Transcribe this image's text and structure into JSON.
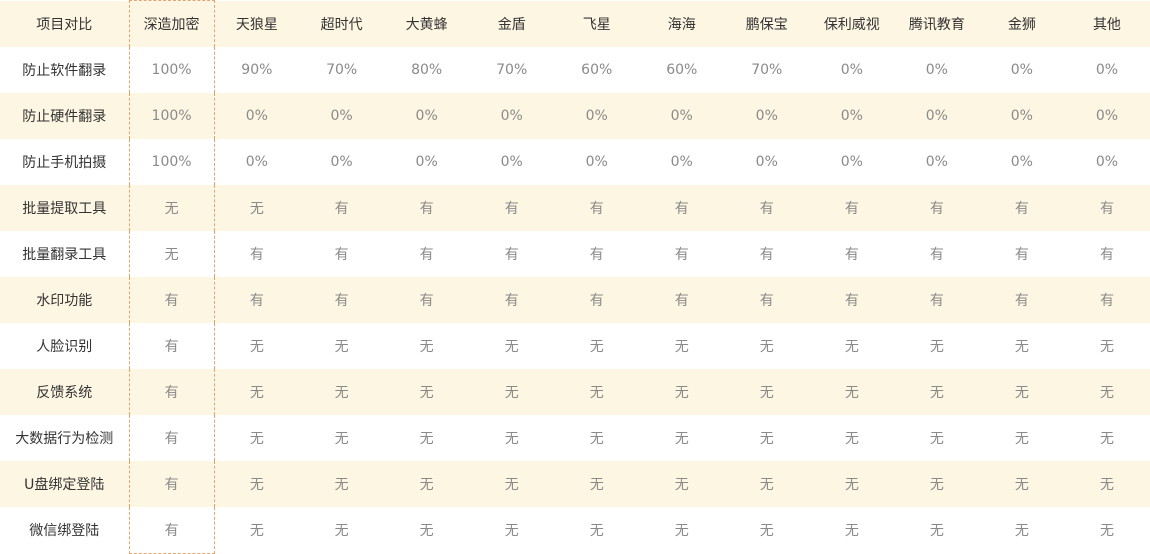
{
  "table": {
    "corner": "项目对比",
    "columns": [
      "深造加密",
      "天狼星",
      "超时代",
      "大黄蜂",
      "金盾",
      "飞星",
      "海海",
      "鹏保宝",
      "保利威视",
      "腾讯教育",
      "金狮",
      "其他"
    ],
    "highlight_column": "深造加密",
    "colors": {
      "shaded_row_bg": "#fdf6e3",
      "highlight_border": "#e8a36b",
      "label_text": "#333333",
      "value_text": "#8a8a8a"
    },
    "rows": [
      {
        "label": "防止软件翻录",
        "values": [
          "100%",
          "90%",
          "70%",
          "80%",
          "70%",
          "60%",
          "60%",
          "70%",
          "0%",
          "0%",
          "0%",
          "0%"
        ]
      },
      {
        "label": "防止硬件翻录",
        "values": [
          "100%",
          "0%",
          "0%",
          "0%",
          "0%",
          "0%",
          "0%",
          "0%",
          "0%",
          "0%",
          "0%",
          "0%"
        ]
      },
      {
        "label": "防止手机拍摄",
        "values": [
          "100%",
          "0%",
          "0%",
          "0%",
          "0%",
          "0%",
          "0%",
          "0%",
          "0%",
          "0%",
          "0%",
          "0%"
        ]
      },
      {
        "label": "批量提取工具",
        "values": [
          "无",
          "无",
          "有",
          "有",
          "有",
          "有",
          "有",
          "有",
          "有",
          "有",
          "有",
          "有"
        ]
      },
      {
        "label": "批量翻录工具",
        "values": [
          "无",
          "有",
          "有",
          "有",
          "有",
          "有",
          "有",
          "有",
          "有",
          "有",
          "有",
          "有"
        ]
      },
      {
        "label": "水印功能",
        "values": [
          "有",
          "有",
          "有",
          "有",
          "有",
          "有",
          "有",
          "有",
          "有",
          "有",
          "有",
          "有"
        ]
      },
      {
        "label": "人脸识别",
        "values": [
          "有",
          "无",
          "无",
          "无",
          "无",
          "无",
          "无",
          "无",
          "无",
          "无",
          "无",
          "无"
        ]
      },
      {
        "label": "反馈系统",
        "values": [
          "有",
          "无",
          "无",
          "无",
          "无",
          "无",
          "无",
          "无",
          "无",
          "无",
          "无",
          "无"
        ]
      },
      {
        "label": "大数据行为检测",
        "values": [
          "有",
          "无",
          "无",
          "无",
          "无",
          "无",
          "无",
          "无",
          "无",
          "无",
          "无",
          "无"
        ]
      },
      {
        "label": "U盘绑定登陆",
        "values": [
          "有",
          "无",
          "无",
          "无",
          "无",
          "无",
          "无",
          "无",
          "无",
          "无",
          "无",
          "无"
        ]
      },
      {
        "label": "微信绑登陆",
        "values": [
          "有",
          "无",
          "无",
          "无",
          "无",
          "无",
          "无",
          "无",
          "无",
          "无",
          "无",
          "无"
        ]
      }
    ]
  }
}
